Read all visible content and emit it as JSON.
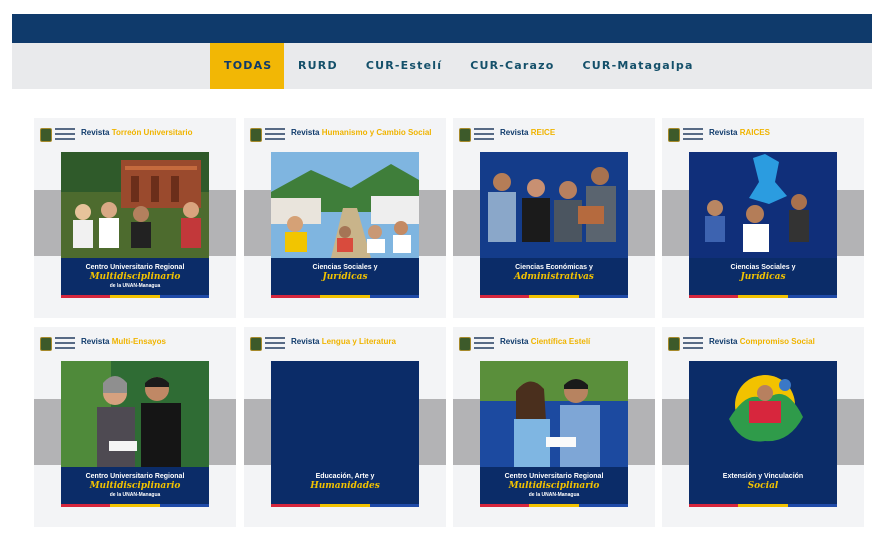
{
  "tabs": [
    {
      "label": "TODAS",
      "active": true
    },
    {
      "label": "RURD"
    },
    {
      "label": "CUR-Estelí"
    },
    {
      "label": "CUR-Carazo"
    },
    {
      "label": "CUR-Matagalpa"
    }
  ],
  "cards": [
    {
      "title_prefix": "Revista",
      "title_accent": "Torreón Universitario",
      "caption": "Centro Universitario Regional",
      "caption_script": "Multidisciplinario",
      "caption_sub": "de la UNAN-Managua",
      "photo": "campus-building"
    },
    {
      "title_prefix": "Revista",
      "title_accent": "Humanismo y Cambio Social",
      "caption": "Ciencias Sociales y",
      "caption_script": "Jurídicas",
      "caption_sub": "",
      "photo": "community-street"
    },
    {
      "title_prefix": "Revista",
      "title_accent": "REICE",
      "caption": "Ciencias Económicas y",
      "caption_script": "Administrativas",
      "caption_sub": "",
      "photo": "four-people"
    },
    {
      "title_prefix": "Revista",
      "title_accent": "RAICES",
      "caption": "Ciencias Sociales y",
      "caption_script": "Jurídicas",
      "caption_sub": "",
      "photo": "statue-students"
    },
    {
      "title_prefix": "Revista",
      "title_accent": "Multi-Ensayos",
      "caption": "Centro Universitario Regional",
      "caption_script": "Multidisciplinario",
      "caption_sub": "de la UNAN-Managua",
      "photo": "two-readers"
    },
    {
      "title_prefix": "Revista",
      "title_accent": "Lengua y Literatura",
      "caption": "Educación, Arte y",
      "caption_script": "Humanidades",
      "caption_sub": "",
      "photo": "none"
    },
    {
      "title_prefix": "Revista",
      "title_accent": "Científica Estelí",
      "caption": "Centro Universitario Regional",
      "caption_script": "Multidisciplinario",
      "caption_sub": "de la UNAN-Managua",
      "photo": "students-book"
    },
    {
      "title_prefix": "Revista",
      "title_accent": "Compromiso Social",
      "caption": "Extensión y Vinculación",
      "caption_script": "Social",
      "caption_sub": "",
      "photo": "illustration"
    }
  ]
}
